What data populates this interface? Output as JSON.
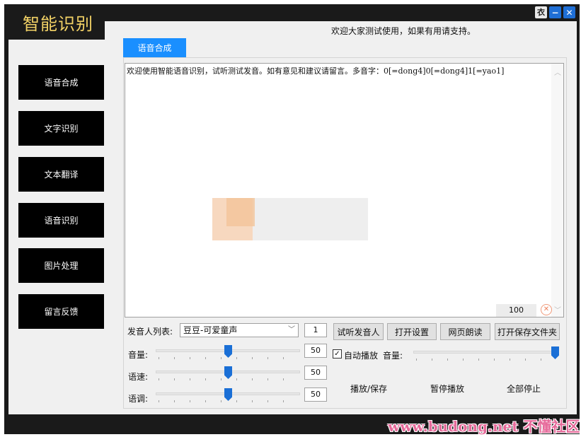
{
  "app": {
    "title": "智能识别",
    "welcome": "欢迎大家测试使用，如果有用请支持。"
  },
  "window_controls": {
    "skin": "衣",
    "minimize": "−",
    "close": "✕"
  },
  "nav": [
    {
      "label": "语音合成"
    },
    {
      "label": "文字识别"
    },
    {
      "label": "文本翻译"
    },
    {
      "label": "语音识别"
    },
    {
      "label": "图片处理"
    },
    {
      "label": "留言反馈"
    }
  ],
  "tab": {
    "label": "语音合成"
  },
  "editor": {
    "text": "欢迎使用智能语音识别，试听测试发音。如有意见和建议请留言。多音字：0[=dong4]0[=dong4]1[=yao1]",
    "counter": "100"
  },
  "controls": {
    "speaker_label": "发音人列表:",
    "speaker_value": "豆豆-可爱童声",
    "speaker_count": "1",
    "volume_label": "音量:",
    "volume_value": "50",
    "volume_level": 50,
    "speed_label": "语速:",
    "speed_value": "50",
    "speed_level": 50,
    "pitch_label": "语调:",
    "pitch_value": "50",
    "pitch_level": 50,
    "auto_play_label": "自动播放",
    "auto_play_checked": true,
    "play_volume_label": "音量:",
    "play_volume_level": 100
  },
  "buttons": {
    "preview_speaker": "试听发音人",
    "open_settings": "打开设置",
    "web_read": "网页朗读",
    "open_save_folder": "打开保存文件夹",
    "play_save": "播放/保存",
    "pause": "暂停播放",
    "stop_all": "全部停止"
  },
  "watermark": "www.budong.net 不懂社区"
}
